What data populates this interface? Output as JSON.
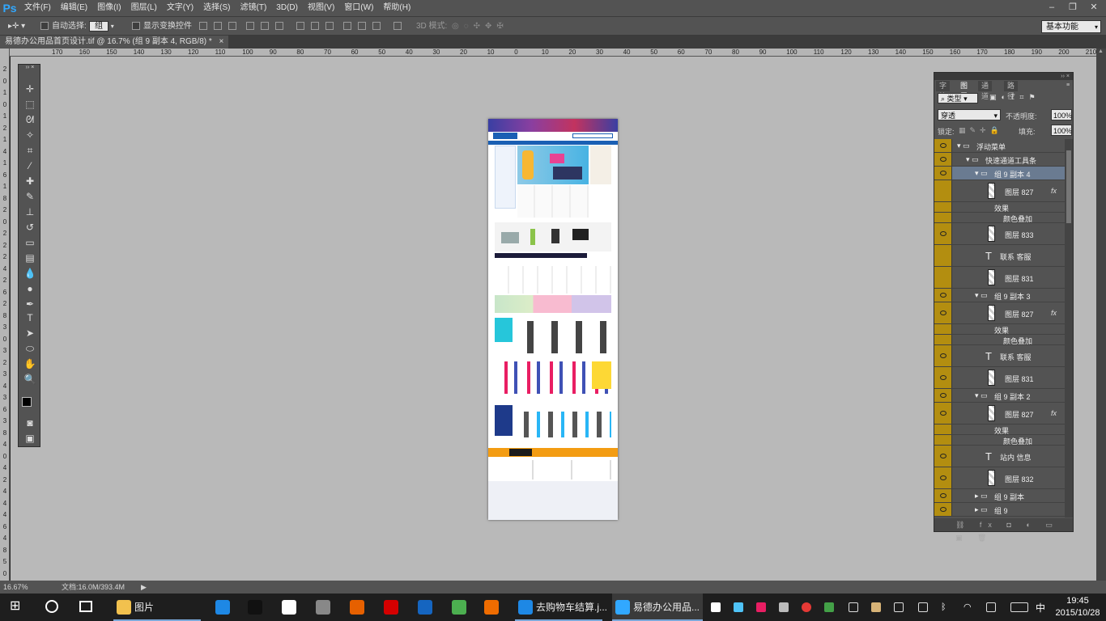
{
  "app": {
    "logo": "Ps"
  },
  "menu": [
    "文件(F)",
    "编辑(E)",
    "图像(I)",
    "图层(L)",
    "文字(Y)",
    "选择(S)",
    "滤镜(T)",
    "3D(D)",
    "视图(V)",
    "窗口(W)",
    "帮助(H)"
  ],
  "options": {
    "auto_select_label": "自动选择:",
    "auto_select_value": "组",
    "show_transform_label": "显示变换控件",
    "mode_3d_label": "3D 模式:",
    "workspace": "基本功能"
  },
  "document": {
    "tab_title": "易德办公用品首页设计.tif @ 16.7% (组 9 副本 4, RGB/8) *"
  },
  "ruler": {
    "h_ticks": [
      "170",
      "160",
      "150",
      "140",
      "130",
      "120",
      "110",
      "100",
      "90",
      "80",
      "70",
      "60",
      "50",
      "40",
      "30",
      "20",
      "10",
      "0",
      "10",
      "20",
      "30",
      "40",
      "50",
      "60",
      "70",
      "80",
      "90",
      "100",
      "110",
      "120",
      "130",
      "140",
      "150",
      "160",
      "170",
      "180",
      "190",
      "200",
      "210",
      "220",
      "230",
      "240",
      "250",
      "260",
      "270",
      "280",
      "290",
      "300",
      "310",
      "320"
    ],
    "v_ticks": [
      "2",
      "0",
      "1",
      "0",
      "1",
      "2",
      "1",
      "4",
      "1",
      "6",
      "1",
      "8",
      "2",
      "0",
      "2",
      "2",
      "2",
      "4",
      "2",
      "6",
      "2",
      "8",
      "3",
      "0",
      "3",
      "2",
      "3",
      "4",
      "3",
      "6",
      "3",
      "8",
      "4",
      "0",
      "4",
      "2",
      "4",
      "4",
      "4",
      "6",
      "4",
      "8",
      "5",
      "0"
    ]
  },
  "status": {
    "zoom": "16.67%",
    "doc_size": "文档:16.0M/393.4M"
  },
  "layers_panel": {
    "tabs": [
      "字符",
      "图层",
      "通道",
      "路径"
    ],
    "active_tab": "图层",
    "filter_kind": "类型",
    "blend_mode": "穿透",
    "opacity_label": "不透明度:",
    "opacity_value": "100%",
    "lock_label": "锁定:",
    "fill_label": "填充:",
    "fill_value": "100%",
    "layers": [
      {
        "name": "浮动菜单",
        "kind": "group",
        "indent": 0,
        "visible": true,
        "selected": false
      },
      {
        "name": "快速通道工具条",
        "kind": "group",
        "indent": 1,
        "visible": true,
        "selected": false
      },
      {
        "name": "组 9 副本 4",
        "kind": "group",
        "indent": 2,
        "visible": true,
        "selected": true
      },
      {
        "name": "图层 827",
        "kind": "pixel",
        "indent": 3,
        "visible": false,
        "fx": true
      },
      {
        "name": "效果",
        "kind": "effect",
        "indent": 4
      },
      {
        "name": "颜色叠加",
        "kind": "effect2",
        "indent": 5
      },
      {
        "name": "图层 833",
        "kind": "pixel",
        "indent": 3,
        "visible": true
      },
      {
        "name": "联系 客服",
        "kind": "text",
        "indent": 3,
        "visible": false
      },
      {
        "name": "图层 831",
        "kind": "pixel",
        "indent": 3,
        "visible": false
      },
      {
        "name": "组 9 副本 3",
        "kind": "group",
        "indent": 2,
        "visible": true
      },
      {
        "name": "图层 827",
        "kind": "pixel",
        "indent": 3,
        "visible": true,
        "fx": true
      },
      {
        "name": "效果",
        "kind": "effect",
        "indent": 4
      },
      {
        "name": "颜色叠加",
        "kind": "effect2",
        "indent": 5
      },
      {
        "name": "联系 客服",
        "kind": "text",
        "indent": 3,
        "visible": true
      },
      {
        "name": "图层 831",
        "kind": "pixel",
        "indent": 3,
        "visible": true
      },
      {
        "name": "组 9 副本 2",
        "kind": "group",
        "indent": 2,
        "visible": true
      },
      {
        "name": "图层 827",
        "kind": "pixel",
        "indent": 3,
        "visible": true,
        "fx": true
      },
      {
        "name": "效果",
        "kind": "effect",
        "indent": 4
      },
      {
        "name": "颜色叠加",
        "kind": "effect2",
        "indent": 5
      },
      {
        "name": "站内 信息",
        "kind": "text",
        "indent": 3,
        "visible": true
      },
      {
        "name": "图层 832",
        "kind": "pixel",
        "indent": 3,
        "visible": true
      },
      {
        "name": "组 9 副本",
        "kind": "group-closed",
        "indent": 2,
        "visible": true
      },
      {
        "name": "组 9",
        "kind": "group-closed",
        "indent": 2,
        "visible": true
      }
    ]
  },
  "taskbar": {
    "apps": [
      {
        "label": "图片",
        "icon": "folder-icon",
        "color": "#f2c14e"
      },
      {
        "label": "",
        "icon": "edge-icon",
        "color": "#1e88e5"
      },
      {
        "label": "",
        "icon": "qq-icon",
        "color": "#111"
      },
      {
        "label": "",
        "icon": "store-icon",
        "color": "#fff"
      },
      {
        "label": "",
        "icon": "app-icon",
        "color": "#888"
      },
      {
        "label": "",
        "icon": "firefox-icon",
        "color": "#e66000"
      },
      {
        "label": "",
        "icon": "opera-icon",
        "color": "#d50000"
      },
      {
        "label": "",
        "icon": "calendar-icon",
        "color": "#1565c0"
      },
      {
        "label": "",
        "icon": "chrome-icon",
        "color": "#4caf50"
      },
      {
        "label": "",
        "icon": "ftp-icon",
        "color": "#ef6c00"
      },
      {
        "label": "去购物车结算.j...",
        "icon": "ie-icon",
        "color": "#1e88e5"
      },
      {
        "label": "易德办公用品...",
        "icon": "photoshop-icon",
        "color": "#31a8ff"
      }
    ],
    "time": "19:45",
    "date": "2015/10/28",
    "ime": "中"
  }
}
